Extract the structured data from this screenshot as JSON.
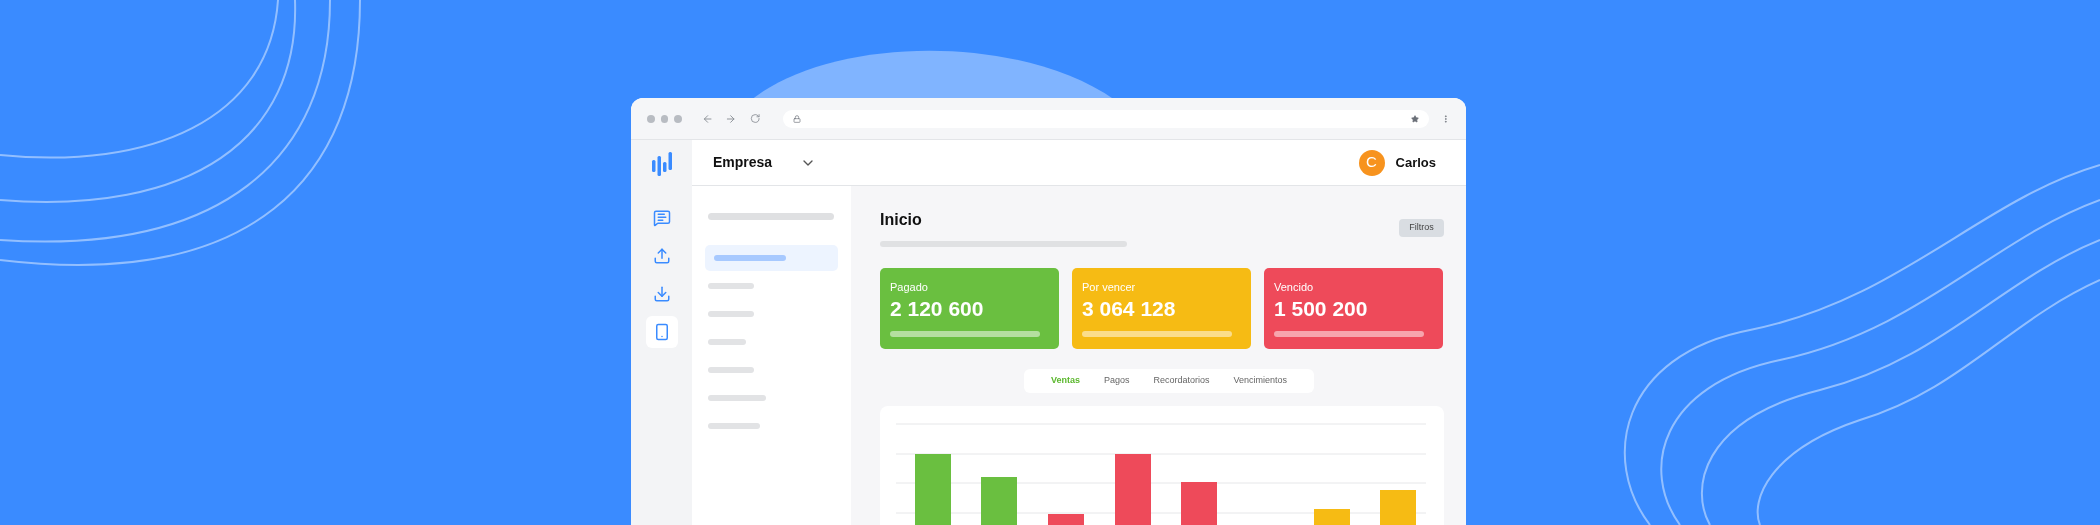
{
  "sidebar": {
    "icons": [
      {
        "kind": "message",
        "selected": false
      },
      {
        "kind": "upload",
        "selected": false
      },
      {
        "kind": "download",
        "selected": false
      },
      {
        "kind": "phone",
        "selected": true
      }
    ]
  },
  "header": {
    "company": "Empresa",
    "avatar_initial": "C",
    "user_name": "Carlos"
  },
  "nav": {
    "items": [
      {
        "selected": true
      },
      {
        "selected": false
      },
      {
        "selected": false
      },
      {
        "selected": false
      },
      {
        "selected": false
      },
      {
        "selected": false
      },
      {
        "selected": false
      }
    ]
  },
  "page": {
    "title": "Inicio",
    "filter_button": "Filtros"
  },
  "cards": [
    {
      "label": "Pagado",
      "value": "2 120 600",
      "color": "#6abf40"
    },
    {
      "label": "Por vencer",
      "value": "3 064 128",
      "color": "#f6bb14"
    },
    {
      "label": "Vencido",
      "value": "1 500 200",
      "color": "#ee4a5a"
    }
  ],
  "tabs": [
    {
      "label": "Ventas",
      "selected": true
    },
    {
      "label": "Pagos",
      "selected": false
    },
    {
      "label": "Recordatorios",
      "selected": false
    },
    {
      "label": "Vencimientos",
      "selected": false
    }
  ]
}
